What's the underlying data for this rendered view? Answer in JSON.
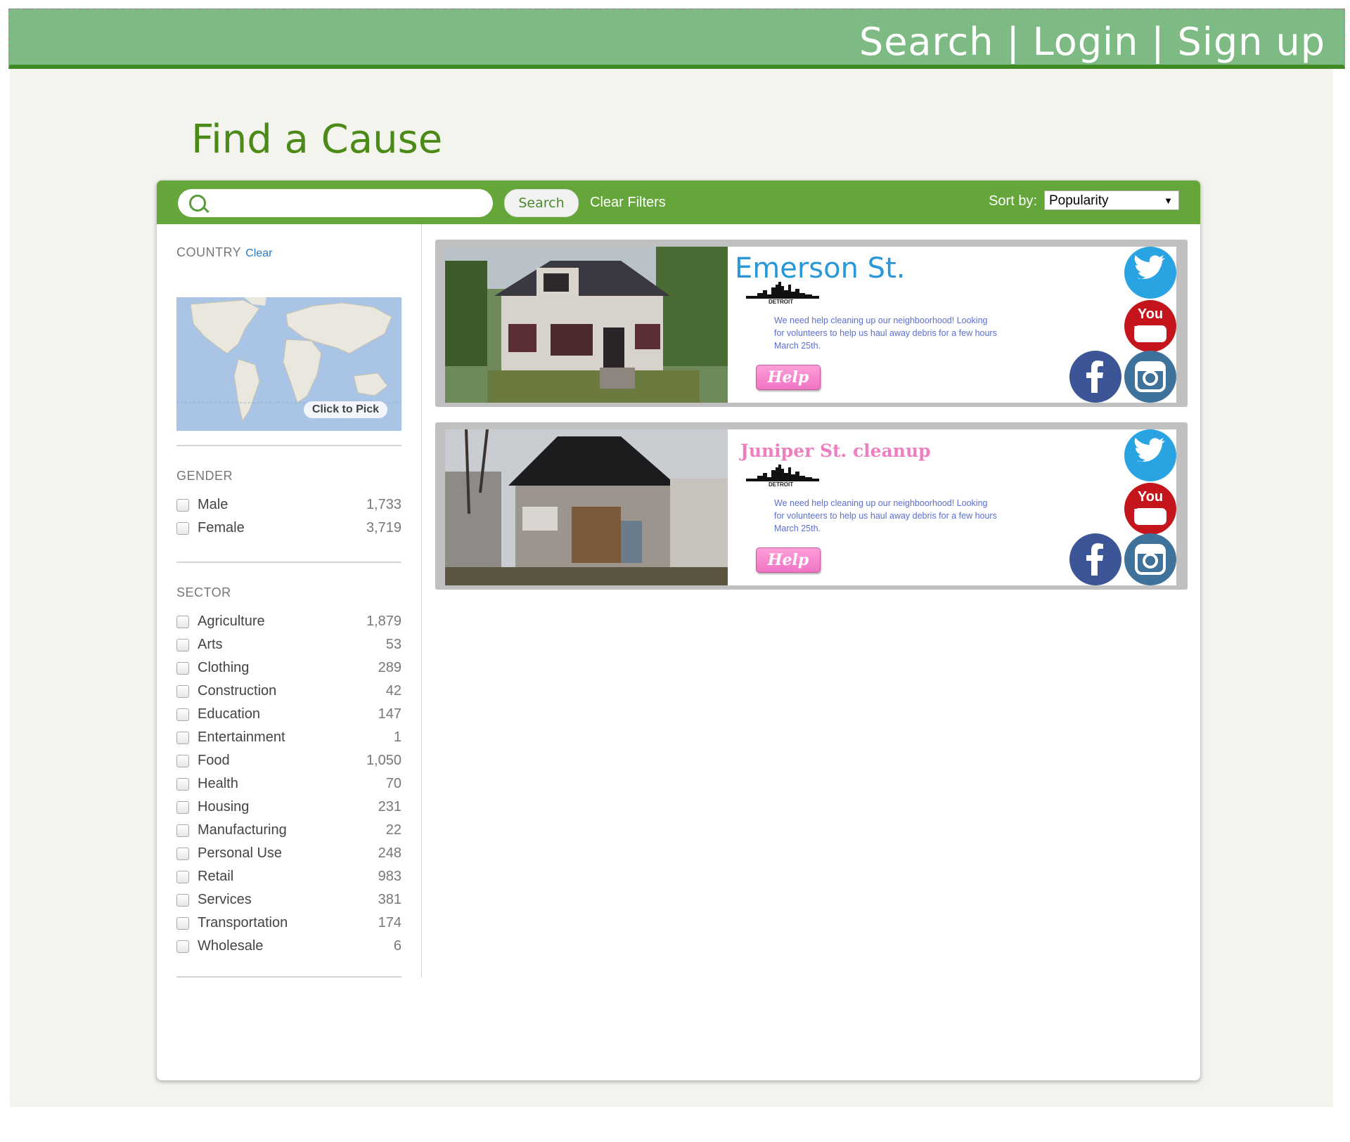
{
  "nav": {
    "search": "Search",
    "sep1": "|",
    "login": "Login",
    "sep2": "|",
    "signup": "Sign up"
  },
  "page_title": "Find a Cause",
  "toolbar": {
    "search_button": "Search",
    "clear_filters": "Clear Filters",
    "sort_label": "Sort by:",
    "sort_value": "Popularity"
  },
  "filters": {
    "country": {
      "title": "COUNTRY",
      "clear": "Clear",
      "map_pick": "Click to Pick"
    },
    "gender": {
      "title": "GENDER",
      "items": [
        {
          "label": "Male",
          "count": "1,733"
        },
        {
          "label": "Female",
          "count": "3,719"
        }
      ]
    },
    "sector": {
      "title": "SECTOR",
      "items": [
        {
          "label": "Agriculture",
          "count": "1,879"
        },
        {
          "label": "Arts",
          "count": "53"
        },
        {
          "label": "Clothing",
          "count": "289"
        },
        {
          "label": "Construction",
          "count": "42"
        },
        {
          "label": "Education",
          "count": "147"
        },
        {
          "label": "Entertainment",
          "count": "1"
        },
        {
          "label": "Food",
          "count": "1,050"
        },
        {
          "label": "Health",
          "count": "70"
        },
        {
          "label": "Housing",
          "count": "231"
        },
        {
          "label": "Manufacturing",
          "count": "22"
        },
        {
          "label": "Personal Use",
          "count": "248"
        },
        {
          "label": "Retail",
          "count": "983"
        },
        {
          "label": "Services",
          "count": "381"
        },
        {
          "label": "Transportation",
          "count": "174"
        },
        {
          "label": "Wholesale",
          "count": "6"
        }
      ]
    }
  },
  "causes": [
    {
      "title": "Emerson St.",
      "city": "DETROIT",
      "description": "We need help cleaning up our neighboorhood! Looking for volunteers to help us haul away debris for a few hours March 25th.",
      "help": "Help",
      "youtube": "You Tube"
    },
    {
      "title": "Juniper St. cleanup",
      "city": "DETROIT",
      "description": "We need help cleaning up our neighboorhood! Looking for volunteers to help us haul away debris for a few hours March 25th.",
      "help": "Help",
      "youtube": "You Tube"
    }
  ]
}
